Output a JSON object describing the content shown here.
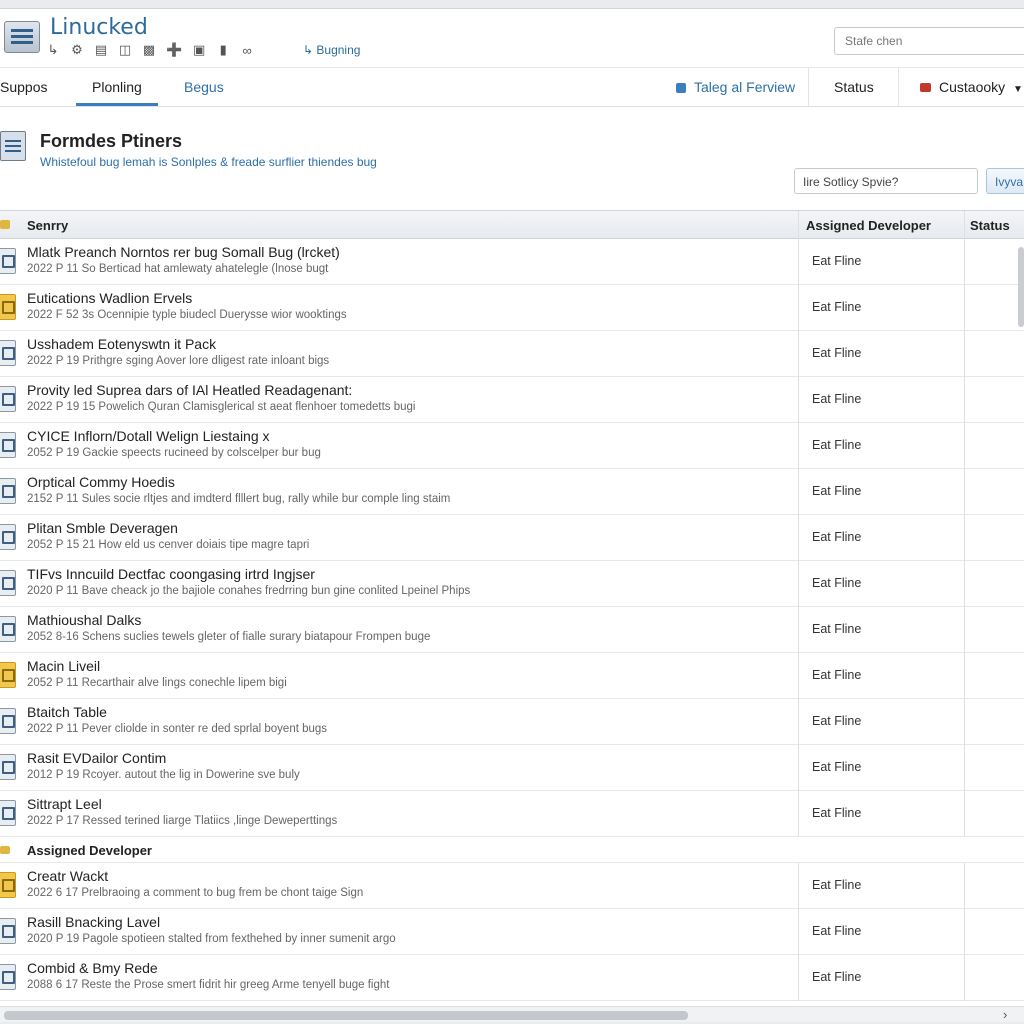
{
  "app": {
    "title": "Linucked"
  },
  "toolbar": {
    "icons": [
      "arrow-icon",
      "gear-icon",
      "speaker-icon",
      "device-icon",
      "camera-icon",
      "plus-icon",
      "window-icon",
      "folder-icon",
      "link-icon"
    ],
    "bugging_label": "Bugning",
    "search_placeholder": "Stafe chen"
  },
  "nav": {
    "tabs": [
      {
        "label": "Suppos"
      },
      {
        "label": "Plonling"
      },
      {
        "label": "Begus"
      }
    ],
    "right": {
      "teleg_label": "Taleg al Ferview",
      "status_label": "Status",
      "custom_label": "Custaooky"
    }
  },
  "section": {
    "title": "Formdes Ptiners",
    "subtitle": "Whistefoul bug lemah is Sonlples & freade surflier thiendes bug",
    "filter_placeholder": "Iire Sotlicy Spvie?",
    "filter_button": "Ivyva"
  },
  "table": {
    "headers": {
      "summary": "Senrry",
      "developer": "Assigned Developer",
      "status": "Status"
    },
    "rows": [
      {
        "title": "Mlatk Preanch Norntos rer bug Somall Bug (lrcket)",
        "desc": "2022 P 11  So Berticad hat amlewaty ahatelegle (lnose bugt",
        "dev": "Eat Fline",
        "icon": "gray"
      },
      {
        "title": "Eutications Wadlion Ervels",
        "desc": "2022 F 52  3s Ocennipie typle biudecl Duerysse wior wooktings",
        "dev": "Eat Fline",
        "icon": "yellow"
      },
      {
        "title": "Usshadem Eotenyswtn it Pack",
        "desc": "2022 P 19  Prithgre sging Aover lore dligest rate inloant bigs",
        "dev": "Eat Fline",
        "icon": "gray"
      },
      {
        "title": "Provity led Suprea dars of IAl Heatled Readagenant:",
        "desc": "2022 P 19 15  Powelich Quran Clamisglerical st aeat flenhoer tomedetts bugi",
        "dev": "Eat Fline",
        "icon": "gray"
      },
      {
        "title": "CYICE Inflorn/Dotall Welign Liestaing x",
        "desc": "2052 P 19  Gackie speects rucineed by colscelper bur bug",
        "dev": "Eat Fline",
        "icon": "gray"
      },
      {
        "title": "Orptical Commy Hoedis",
        "desc": "2152 P 11  Sules socie rltjes and imdterd flllert bug, rally while bur comple ling staim",
        "dev": "Eat Fline",
        "icon": "gray"
      },
      {
        "title": "Plitan Smble Deveragen",
        "desc": "2052 P 15 21  How eld us cenver doiais tipe magre tapri",
        "dev": "Eat Fline",
        "icon": "gray"
      },
      {
        "title": "TIFvs Inncuild Dectfac coongasing irtrd Ingjser",
        "desc": "2020 P 11  Bave cheack jo the bajiole conahes fredrring bun gine conlited Lpeinel Phips",
        "dev": "Eat Fline",
        "icon": "gray"
      },
      {
        "title": "Mathioushal Dalks",
        "desc": "2052 8-16  Schens suclies tewels gleter of fialle surary biatapour Frompen buge",
        "dev": "Eat Fline",
        "icon": "gray"
      },
      {
        "title": "Macin Liveil",
        "desc": "2052 P 11  Recarthair alve lings conechle lipem bigi",
        "dev": "Eat Fline",
        "icon": "yellow"
      },
      {
        "title": "Btaitch Table",
        "desc": "2022 P 11  Pever cliolde in sonter re ded sprlal boyent bugs",
        "dev": "Eat Fline",
        "icon": "gray"
      },
      {
        "title": "Rasit EVDailor Contim",
        "desc": "2012 P 19  Rcoyer. autout the lig in Dowerine sve buly",
        "dev": "Eat Fline",
        "icon": "gray"
      },
      {
        "title": "Sittrapt Leel",
        "desc": "2022 P 17  Ressed terined liarge Tlatiics ,linge Deweperttings",
        "dev": "Eat Fline",
        "icon": "gray"
      }
    ],
    "group_label": "Assigned Developer",
    "group_rows": [
      {
        "title": "Creatr Wackt",
        "desc": "2022 6 17  Prelbraoing a comment to bug frem be chont taige Sign",
        "dev": "Eat Fline",
        "icon": "yellow"
      },
      {
        "title": "Rasill Bnacking Lavel",
        "desc": "2020 P 19  Pagole spotieen stalted from fexthehed by inner sumenit argo",
        "dev": "Eat Fline",
        "icon": "gray"
      },
      {
        "title": "Combid & Bmy Rede",
        "desc": "2088 6 17  Reste the Prose smert fidrit hir greeg Arme tenyell buge fight",
        "dev": "Eat Fline",
        "icon": "gray"
      }
    ]
  }
}
